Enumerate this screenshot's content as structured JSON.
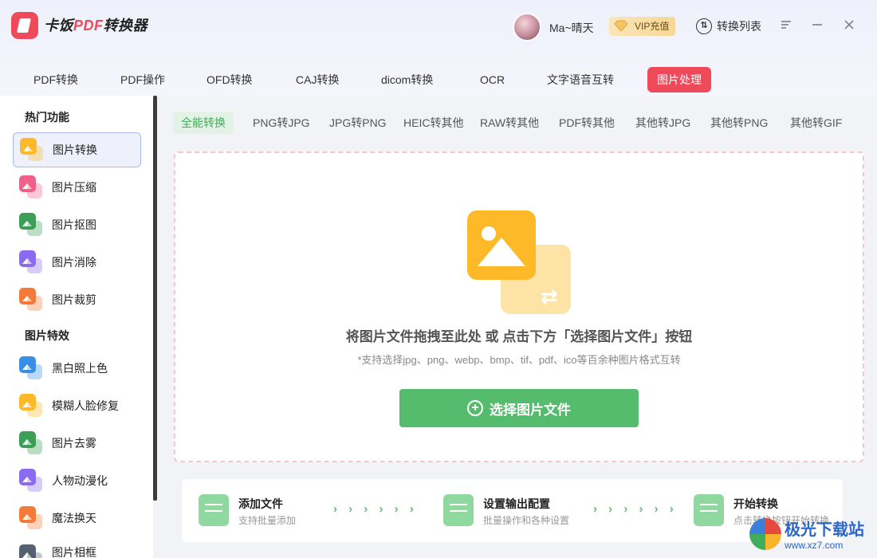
{
  "app": {
    "title_prefix": "卡饭",
    "title_pdf": "PDF",
    "title_suffix": "转换器"
  },
  "user": {
    "name": "Ma~晴天",
    "vip_label": "VIP充值"
  },
  "header": {
    "convert_list_label": "转换列表",
    "convert_list_icon": "⇅"
  },
  "top_tabs": [
    "PDF转换",
    "PDF操作",
    "OFD转换",
    "CAJ转换",
    "dicom转换",
    "OCR",
    "文字语音互转",
    "图片处理"
  ],
  "sidebar": {
    "section1": "热门功能",
    "section2": "图片特效",
    "items": [
      {
        "label": "图片转换",
        "color": "#fdb927"
      },
      {
        "label": "图片压缩",
        "color": "#f0608a"
      },
      {
        "label": "图片抠图",
        "color": "#3d9e57"
      },
      {
        "label": "图片消除",
        "color": "#8b6cf0"
      },
      {
        "label": "图片裁剪",
        "color": "#f57a3a"
      },
      {
        "label": "黑白照上色",
        "color": "#3a8ee8"
      },
      {
        "label": "模糊人脸修复",
        "color": "#fdb927"
      },
      {
        "label": "图片去雾",
        "color": "#3d9e57"
      },
      {
        "label": "人物动漫化",
        "color": "#8b6cf0"
      },
      {
        "label": "魔法换天",
        "color": "#f57a3a"
      },
      {
        "label": "图片相框",
        "color": "#556070"
      }
    ]
  },
  "sub_tabs": [
    "全能转换",
    "PNG转JPG",
    "JPG转PNG",
    "HEIC转其他",
    "RAW转其他",
    "PDF转其他",
    "其他转JPG",
    "其他转PNG",
    "其他转GIF"
  ],
  "dropzone": {
    "title": "将图片文件拖拽至此处 或 点击下方「选择图片文件」按钮",
    "subtitle": "*支持选择jpg、png、webp、bmp、tif、pdf、ico等百余种图片格式互转",
    "button": "选择图片文件"
  },
  "steps": [
    {
      "title": "添加文件",
      "desc": "支持批量添加"
    },
    {
      "title": "设置输出配置",
      "desc": "批量操作和各种设置"
    },
    {
      "title": "开始转换",
      "desc": "点击转换按钮开始转换"
    }
  ],
  "chevrons": "› › › › › ›",
  "watermark": {
    "name": "极光下载站",
    "url": "www.xz7.com"
  },
  "colors": {
    "accent_red": "#ef4a5a",
    "accent_green": "#56bc6d"
  }
}
